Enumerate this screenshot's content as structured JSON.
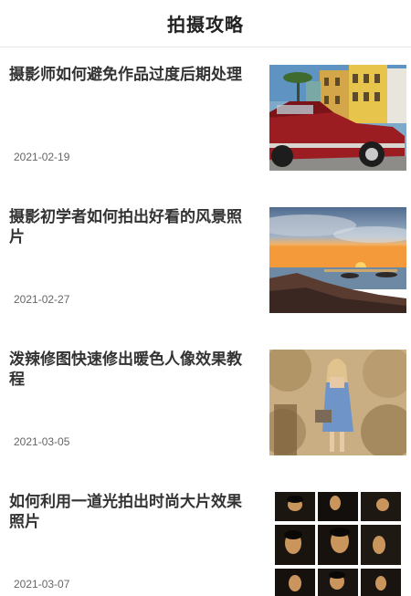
{
  "header": {
    "title": "拍摄攻略"
  },
  "articles": [
    {
      "title": "摄影师如何避免作品过度后期处理",
      "date": "2021-02-19",
      "thumb": "vintage-red-car-photo"
    },
    {
      "title": "摄影初学者如何拍出好看的风景照片",
      "date": "2021-02-27",
      "thumb": "sunset-seascape-photo"
    },
    {
      "title": "泼辣修图快速修出暖色人像效果教程",
      "date": "2021-03-05",
      "thumb": "warm-portrait-photo"
    },
    {
      "title": "如何利用一道光拍出时尚大片效果照片",
      "date": "2021-03-07",
      "thumb": "fashion-portrait-grid-photo"
    }
  ]
}
